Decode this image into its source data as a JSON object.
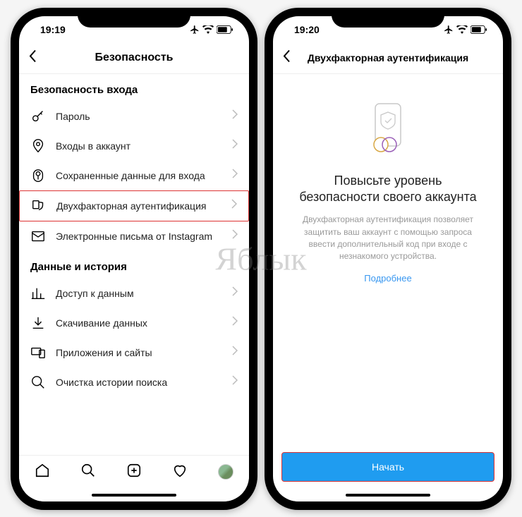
{
  "watermark": "Яблык",
  "left": {
    "time": "19:19",
    "title": "Безопасность",
    "sections": [
      {
        "header": "Безопасность входа",
        "items": [
          {
            "icon": "key",
            "label": "Пароль"
          },
          {
            "icon": "location",
            "label": "Входы в аккаунт"
          },
          {
            "icon": "keyhole",
            "label": "Сохраненные данные для входа"
          },
          {
            "icon": "shield",
            "label": "Двухфакторная аутентификация",
            "highlighted": true
          },
          {
            "icon": "mail",
            "label": "Электронные письма от Instagram"
          }
        ]
      },
      {
        "header": "Данные и история",
        "items": [
          {
            "icon": "chart",
            "label": "Доступ к данным"
          },
          {
            "icon": "download",
            "label": "Скачивание данных"
          },
          {
            "icon": "devices",
            "label": "Приложения и сайты"
          },
          {
            "icon": "search",
            "label": "Очистка истории поиска"
          }
        ]
      }
    ]
  },
  "right": {
    "time": "19:20",
    "title": "Двухфакторная аутентификация",
    "heading": "Повысьте уровень безопасности своего аккаунта",
    "description": "Двухфакторная аутентификация позволяет защитить ваш аккаунт с помощью запроса ввести дополнительный код при входе с незнакомого устройства.",
    "more_link": "Подробнее",
    "button": "Начать"
  },
  "colors": {
    "primary": "#1f9cf0",
    "highlight_border": "#d33",
    "link": "#3897f0"
  }
}
